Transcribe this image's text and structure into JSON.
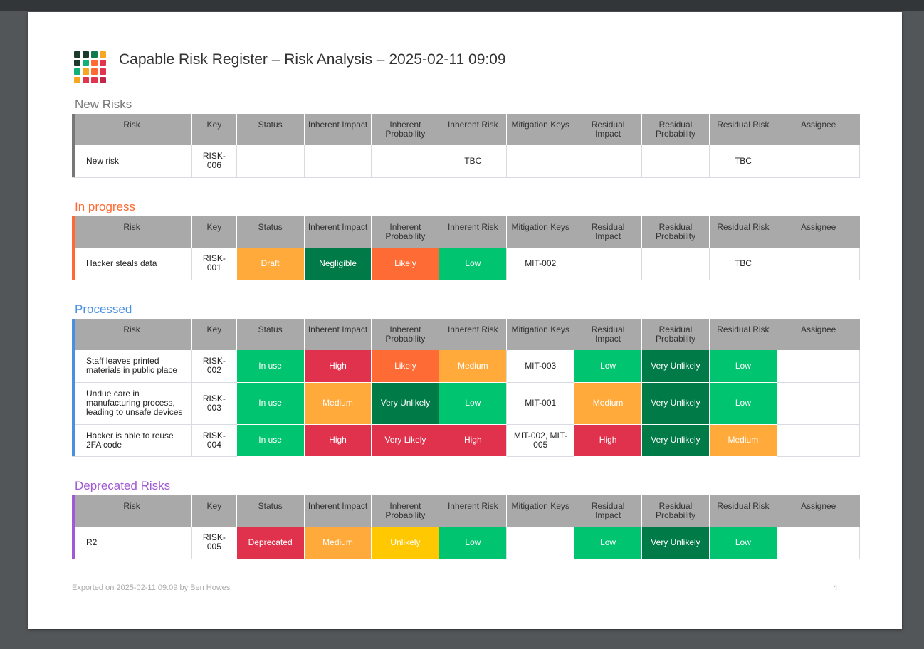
{
  "title": "Capable Risk Register – Risk Analysis – 2025-02-11 09:09",
  "logo_colors": [
    "#1d3b2a",
    "#1d3b2a",
    "#0f7a4c",
    "#f5a623",
    "#1d3b2a",
    "#10b27a",
    "#ff6a33",
    "#e0344f",
    "#10b27a",
    "#f5a623",
    "#ff6a33",
    "#e0344f",
    "#f5a623",
    "#e0344f",
    "#e0344f",
    "#c2264a"
  ],
  "columns": [
    "Risk",
    "Key",
    "Status",
    "Inherent Impact",
    "Inherent Probability",
    "Inherent Risk",
    "Mitigation Keys",
    "Residual Impact",
    "Residual Probability",
    "Residual Risk",
    "Assignee"
  ],
  "colors": {
    "draft": "#ffaa3b",
    "negligible": "#007a46",
    "likely": "#ff6b35",
    "low": "#00c46f",
    "in_use": "#00c46f",
    "high": "#e0314d",
    "medium": "#ffaa3b",
    "very_unlikely": "#007a46",
    "very_likely": "#e0314d",
    "deprecated": "#e0314d",
    "unlikely": "#ffc800"
  },
  "sections": [
    {
      "title": "New Risks",
      "color": "#777777",
      "rows": [
        {
          "cells": [
            "New risk",
            "RISK-\n006",
            "",
            "",
            "",
            "TBC",
            "",
            "",
            "",
            "TBC",
            ""
          ],
          "fills": [
            null,
            null,
            null,
            null,
            null,
            null,
            null,
            null,
            null,
            null,
            null
          ]
        }
      ]
    },
    {
      "title": "In progress",
      "color": "#ff6a33",
      "rows": [
        {
          "cells": [
            "Hacker steals data",
            "RISK-\n001",
            "Draft",
            "Negligible",
            "Likely",
            "Low",
            "MIT-002",
            "",
            "",
            "TBC",
            ""
          ],
          "fills": [
            null,
            null,
            "#ffaa3b",
            "#007a46",
            "#ff6b35",
            "#00c46f",
            null,
            null,
            null,
            null,
            null
          ]
        }
      ]
    },
    {
      "title": "Processed",
      "color": "#4a90e2",
      "rows": [
        {
          "cells": [
            "Staff leaves printed materials in public place",
            "RISK-\n002",
            "In use",
            "High",
            "Likely",
            "Medium",
            "MIT-003",
            "Low",
            "Very Unlikely",
            "Low",
            ""
          ],
          "fills": [
            null,
            null,
            "#00c46f",
            "#e0314d",
            "#ff6b35",
            "#ffaa3b",
            null,
            "#00c46f",
            "#007a46",
            "#00c46f",
            null
          ]
        },
        {
          "cells": [
            "Undue care in manufacturing process, leading to unsafe devices",
            "RISK-\n003",
            "In use",
            "Medium",
            "Very Unlikely",
            "Low",
            "MIT-001",
            "Medium",
            "Very Unlikely",
            "Low",
            ""
          ],
          "fills": [
            null,
            null,
            "#00c46f",
            "#ffaa3b",
            "#007a46",
            "#00c46f",
            null,
            "#ffaa3b",
            "#007a46",
            "#00c46f",
            null
          ]
        },
        {
          "cells": [
            "Hacker is able to reuse 2FA code",
            "RISK-\n004",
            "In use",
            "High",
            "Very Likely",
            "High",
            "MIT-002, MIT-\n005",
            "High",
            "Very Unlikely",
            "Medium",
            ""
          ],
          "fills": [
            null,
            null,
            "#00c46f",
            "#e0314d",
            "#e0314d",
            "#e0314d",
            null,
            "#e0314d",
            "#007a46",
            "#ffaa3b",
            null
          ]
        }
      ]
    },
    {
      "title": "Deprecated Risks",
      "color": "#a05ad6",
      "rows": [
        {
          "cells": [
            "R2",
            "RISK-\n005",
            "Deprecated",
            "Medium",
            "Unlikely",
            "Low",
            "",
            "Low",
            "Very Unlikely",
            "Low",
            ""
          ],
          "fills": [
            null,
            null,
            "#e0314d",
            "#ffaa3b",
            "#ffc800",
            "#00c46f",
            null,
            "#00c46f",
            "#007a46",
            "#00c46f",
            null
          ]
        }
      ]
    }
  ],
  "footer": {
    "exported": "Exported on 2025-02-11 09:09 by Ben Howes",
    "page_number": "1"
  }
}
